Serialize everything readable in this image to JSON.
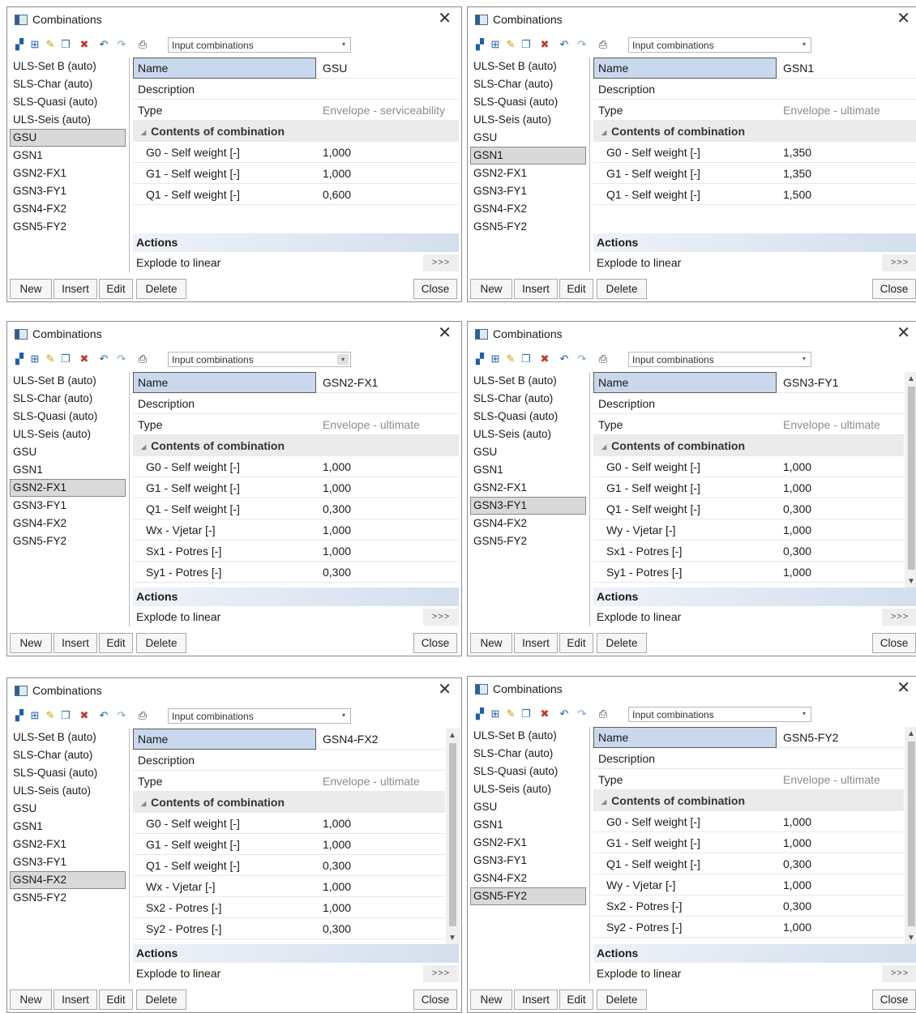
{
  "common": {
    "window_title": "Combinations",
    "close_glyph": "✕",
    "toolbar_combo": "Input combinations",
    "items": [
      "ULS-Set B (auto)",
      "SLS-Char (auto)",
      "SLS-Quasi (auto)",
      "ULS-Seis (auto)",
      "GSU",
      "GSN1",
      "GSN2-FX1",
      "GSN3-FY1",
      "GSN4-FX2",
      "GSN5-FY2"
    ],
    "name_label": "Name",
    "description_label": "Description",
    "type_label": "Type",
    "contents_label": "Contents of combination",
    "actions_label": "Actions",
    "explode_label": "Explode to linear",
    "explode_button": ">>>",
    "btn_new": "New",
    "btn_insert": "Insert",
    "btn_edit": "Edit",
    "btn_delete": "Delete",
    "btn_close": "Close",
    "colors": {
      "selected_name_bg": "#c9d8ec",
      "list_selection": "#d9d9d9",
      "section_bg": "#ebebeb"
    },
    "icons": [
      "new-combination-icon",
      "add-icon",
      "edit-pencil-icon",
      "copy-icon",
      "delete-icon",
      "undo-icon",
      "redo-icon",
      "print-icon"
    ]
  },
  "windows": [
    {
      "selected_index": 4,
      "name": "GSU",
      "type": "Envelope - serviceability",
      "factors": [
        {
          "label": "G0 - Self weight [-]",
          "value": "1,000"
        },
        {
          "label": "G1 - Self weight [-]",
          "value": "1,000"
        },
        {
          "label": "Q1 - Self weight [-]",
          "value": "0,600"
        }
      ]
    },
    {
      "selected_index": 5,
      "name": "GSN1",
      "type": "Envelope - ultimate",
      "factors": [
        {
          "label": "G0 - Self weight [-]",
          "value": "1,350"
        },
        {
          "label": "G1 - Self weight [-]",
          "value": "1,350"
        },
        {
          "label": "Q1 - Self weight [-]",
          "value": "1,500"
        }
      ]
    },
    {
      "selected_index": 6,
      "name": "GSN2-FX1",
      "type": "Envelope - ultimate",
      "factors": [
        {
          "label": "G0 - Self weight [-]",
          "value": "1,000"
        },
        {
          "label": "G1 - Self weight [-]",
          "value": "1,000"
        },
        {
          "label": "Q1 - Self weight [-]",
          "value": "0,300"
        },
        {
          "label": "Wx - Vjetar [-]",
          "value": "1,000"
        },
        {
          "label": "Sx1 - Potres [-]",
          "value": "1,000"
        },
        {
          "label": "Sy1 - Potres [-]",
          "value": "0,300"
        }
      ]
    },
    {
      "selected_index": 7,
      "name": "GSN3-FY1",
      "type": "Envelope - ultimate",
      "factors": [
        {
          "label": "G0 - Self weight [-]",
          "value": "1,000"
        },
        {
          "label": "G1 - Self weight [-]",
          "value": "1,000"
        },
        {
          "label": "Q1 - Self weight [-]",
          "value": "0,300"
        },
        {
          "label": "Wy - Vjetar [-]",
          "value": "1,000"
        },
        {
          "label": "Sx1 - Potres [-]",
          "value": "0,300"
        },
        {
          "label": "Sy1 - Potres [-]",
          "value": "1,000"
        }
      ]
    },
    {
      "selected_index": 8,
      "name": "GSN4-FX2",
      "type": "Envelope - ultimate",
      "factors": [
        {
          "label": "G0 - Self weight [-]",
          "value": "1,000"
        },
        {
          "label": "G1 - Self weight [-]",
          "value": "1,000"
        },
        {
          "label": "Q1 - Self weight [-]",
          "value": "0,300"
        },
        {
          "label": "Wx - Vjetar [-]",
          "value": "1,000"
        },
        {
          "label": "Sx2 - Potres [-]",
          "value": "1,000"
        },
        {
          "label": "Sy2 - Potres [-]",
          "value": "0,300"
        }
      ]
    },
    {
      "selected_index": 9,
      "name": "GSN5-FY2",
      "type": "Envelope - ultimate",
      "factors": [
        {
          "label": "G0 - Self weight [-]",
          "value": "1,000"
        },
        {
          "label": "G1 - Self weight [-]",
          "value": "1,000"
        },
        {
          "label": "Q1 - Self weight [-]",
          "value": "0,300"
        },
        {
          "label": "Wy - Vjetar [-]",
          "value": "1,000"
        },
        {
          "label": "Sx2 - Potres [-]",
          "value": "0,300"
        },
        {
          "label": "Sy2 - Potres [-]",
          "value": "1,000"
        }
      ]
    }
  ]
}
